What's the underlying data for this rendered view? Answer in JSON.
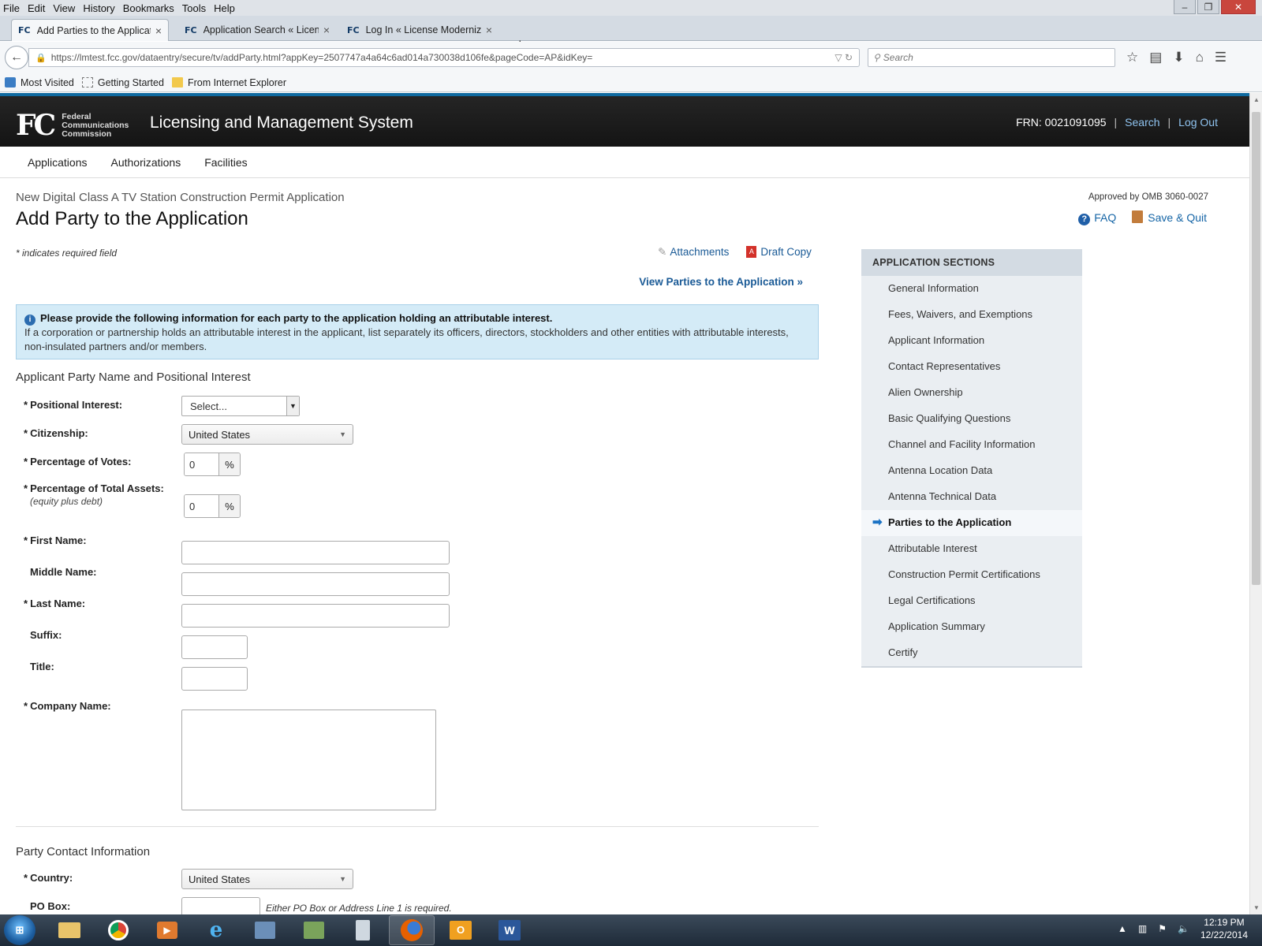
{
  "browser": {
    "menu": [
      "File",
      "Edit",
      "View",
      "History",
      "Bookmarks",
      "Tools",
      "Help"
    ],
    "tabs": [
      {
        "favicon": "FC",
        "label": "Add Parties to the Applicat...",
        "active": true
      },
      {
        "favicon": "FC",
        "label": "Application Search « Licen...",
        "active": false
      },
      {
        "favicon": "FC",
        "label": "Log In « License Moderniza...",
        "active": false
      }
    ],
    "url": "https://lmtest.fcc.gov/dataentry/secure/tv/addParty.html?appKey=2507747a4a64c6ad014a730038d106fe&pageCode=AP&idKey=",
    "search_placeholder": "Search",
    "bookmarks": [
      "Most Visited",
      "Getting Started",
      "From Internet Explorer"
    ]
  },
  "header": {
    "logo_mark": "FC",
    "logo_line1": "Federal",
    "logo_line2": "Communications",
    "logo_line3": "Commission",
    "system_name": "Licensing and Management System",
    "frn": "FRN: 0021091095",
    "search_link": "Search",
    "logout_link": "Log Out"
  },
  "nav": [
    "Applications",
    "Authorizations",
    "Facilities"
  ],
  "page": {
    "breadcrumb": "New Digital Class A TV Station Construction Permit Application",
    "title": "Add Party to the Application",
    "approved": "Approved by OMB 3060-0027",
    "faq": "FAQ",
    "save_quit": "Save & Quit",
    "required_note": "* indicates required field",
    "attachments": "Attachments",
    "draft_copy": "Draft Copy",
    "view_parties": "View Parties to the Application »",
    "info_title": "Please provide the following information for each party to the application holding an attributable interest.",
    "info_body": "If a corporation or partnership holds an attributable interest in the applicant, list separately its officers, directors, stockholders and other entities with attributable interests, non-insulated partners and/or members."
  },
  "form": {
    "section1": "Applicant Party Name and Positional Interest",
    "positional_interest": {
      "label": "Positional Interest:",
      "value": "Select..."
    },
    "citizenship": {
      "label": "Citizenship:",
      "value": "United States"
    },
    "pct_votes": {
      "label": "Percentage of Votes:",
      "value": "0",
      "unit": "%"
    },
    "pct_assets": {
      "label": "Percentage of Total Assets:",
      "sublabel": "(equity plus debt)",
      "value": "0",
      "unit": "%"
    },
    "first_name": {
      "label": "First Name:",
      "value": ""
    },
    "middle_name": {
      "label": "Middle Name:",
      "value": ""
    },
    "last_name": {
      "label": "Last Name:",
      "value": ""
    },
    "suffix": {
      "label": "Suffix:",
      "value": ""
    },
    "title": {
      "label": "Title:",
      "value": ""
    },
    "company_name": {
      "label": "Company Name:",
      "value": ""
    },
    "section2": "Party Contact Information",
    "country": {
      "label": "Country:",
      "value": "United States"
    },
    "po_box": {
      "label": "PO Box:",
      "value": "",
      "hint": "Either PO Box or Address Line 1 is required."
    },
    "required_mark": "*"
  },
  "sidebar": {
    "heading": "APPLICATION SECTIONS",
    "items": [
      {
        "label": "General Information"
      },
      {
        "label": "Fees, Waivers, and Exemptions"
      },
      {
        "label": "Applicant Information"
      },
      {
        "label": "Contact Representatives"
      },
      {
        "label": "Alien Ownership"
      },
      {
        "label": "Basic Qualifying Questions"
      },
      {
        "label": "Channel and Facility Information"
      },
      {
        "label": "Antenna Location Data"
      },
      {
        "label": "Antenna Technical Data"
      },
      {
        "label": "Parties to the Application",
        "active": true
      },
      {
        "label": "Attributable Interest"
      },
      {
        "label": "Construction Permit Certifications"
      },
      {
        "label": "Legal Certifications"
      },
      {
        "label": "Application Summary"
      },
      {
        "label": "Certify"
      }
    ]
  },
  "taskbar": {
    "time": "12:19 PM",
    "date": "12/22/2014"
  },
  "colors": {
    "link": "#1a5a96",
    "header_bg": "#1e1e1e",
    "info_bg": "#d4ebf7",
    "sidebar_bg": "#eaeef2"
  }
}
